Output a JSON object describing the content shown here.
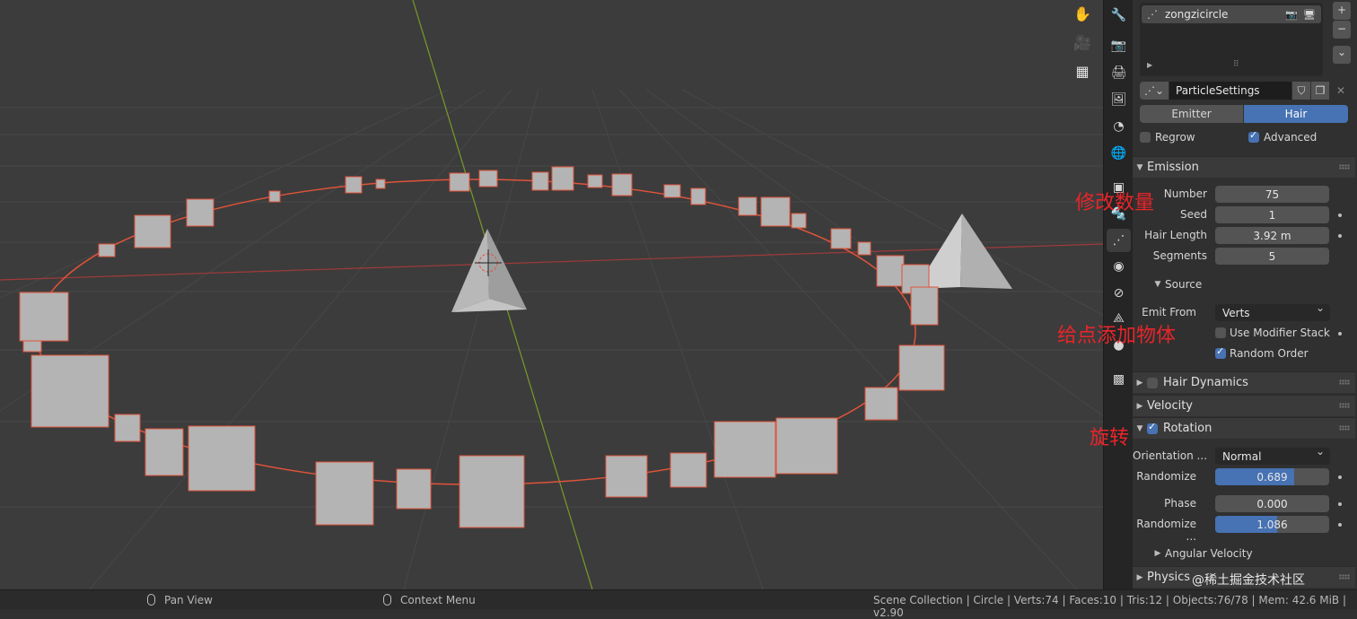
{
  "viewport": {
    "nav_icons": [
      "hand-icon",
      "camera-icon",
      "grid-icon"
    ]
  },
  "property_tabs": [
    "tool-icon",
    "render-icon",
    "output-icon",
    "view-layer-icon",
    "scene-icon",
    "world-icon",
    "object-icon",
    "modifier-icon",
    "particles-icon",
    "physics-icon",
    "constraints-icon",
    "data-icon",
    "material-icon",
    "texture-icon"
  ],
  "particle_list": {
    "item": "zongzicircle",
    "add": "+",
    "remove": "−",
    "more": "⌄"
  },
  "settings": {
    "name": "ParticleSettings",
    "type_options": [
      "Emitter",
      "Hair"
    ],
    "type_selected": "Hair",
    "regrow_label": "Regrow",
    "regrow_checked": false,
    "advanced_label": "Advanced",
    "advanced_checked": true
  },
  "emission": {
    "title": "Emission",
    "number_label": "Number",
    "number": "75",
    "seed_label": "Seed",
    "seed": "1",
    "hair_length_label": "Hair Length",
    "hair_length": "3.92 m",
    "segments_label": "Segments",
    "segments": "5"
  },
  "source": {
    "title": "Source",
    "emit_from_label": "Emit From",
    "emit_from": "Verts",
    "use_modifier_stack": "Use Modifier Stack",
    "use_modifier_stack_checked": false,
    "random_order": "Random Order",
    "random_order_checked": true
  },
  "panels": {
    "hair_dynamics": "Hair Dynamics",
    "velocity": "Velocity",
    "rotation": "Rotation",
    "angular_velocity": "Angular Velocity",
    "physics": "Physics"
  },
  "rotation": {
    "orientation_label": "Orientation ...",
    "orientation": "Normal",
    "randomize_label": "Randomize",
    "randomize": "0.689",
    "randomize_fraction": 0.689,
    "phase_label": "Phase",
    "phase": "0.000",
    "phase_fraction": 0.0,
    "randomize_phase_label": "Randomize ...",
    "randomize_phase": "1.086",
    "randomize_phase_fraction": 0.54
  },
  "annotations": {
    "modify_count": "修改数量",
    "add_objects": "给点添加物体",
    "rotate": "旋转"
  },
  "status_bar": {
    "pan_view": "Pan View",
    "context_menu": "Context Menu",
    "stats": "Scene Collection | Circle | Verts:74 | Faces:10 | Tris:12 | Objects:76/78 | Mem: 42.6 MiB | v2.90",
    "watermark": "@稀土掘金技术社区"
  },
  "colors": {
    "accent": "#4772b3",
    "selection_outline": "#e0533a",
    "annotation": "#e8252a",
    "x_axis": "#a33a3a",
    "y_axis": "#7a9a2a"
  }
}
